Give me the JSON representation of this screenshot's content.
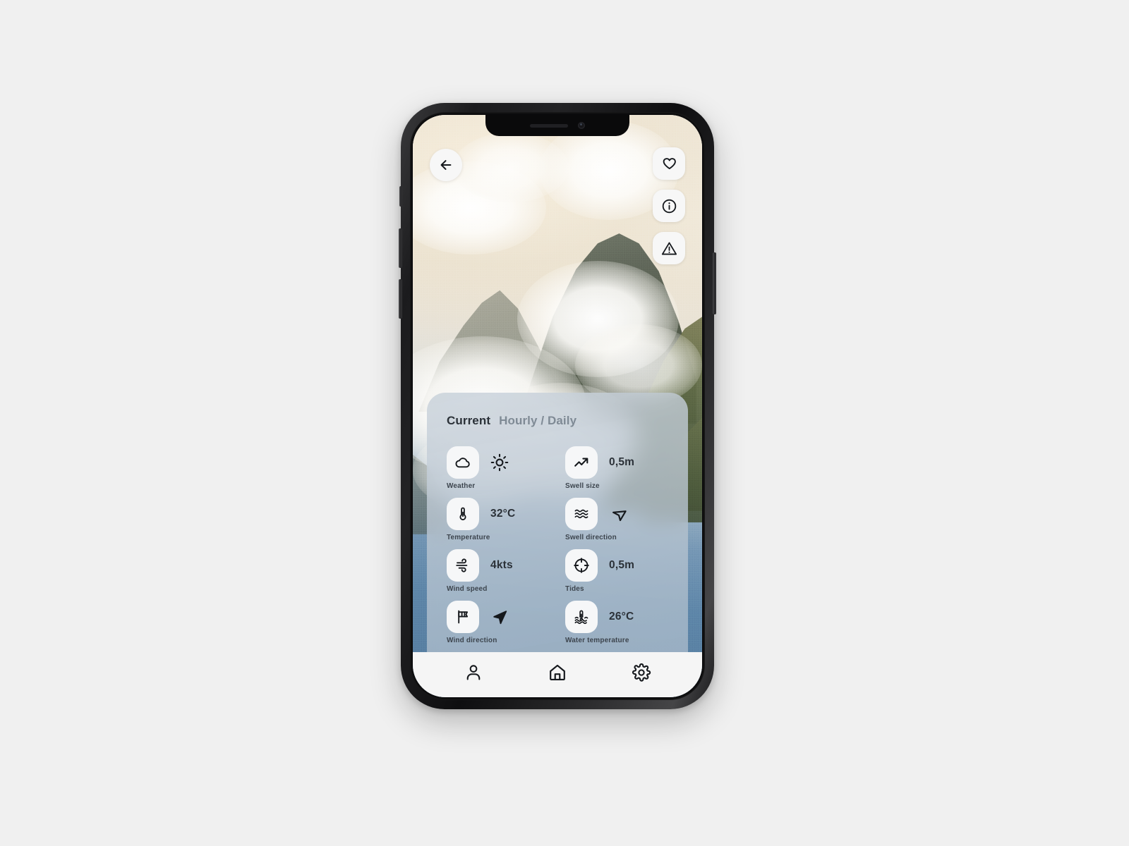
{
  "app": {
    "device": "iphone-x",
    "screen_background": "misty-mountain-lake-photo"
  },
  "header": {
    "back_button": {
      "icon": "arrow-left-icon",
      "label": "Back"
    },
    "actions": [
      {
        "icon": "heart-icon",
        "label": "Favorite"
      },
      {
        "icon": "info-icon",
        "label": "Information"
      },
      {
        "icon": "warning-icon",
        "label": "Alerts"
      }
    ]
  },
  "card": {
    "tabs": [
      {
        "id": "current",
        "label": "Current",
        "active": true
      },
      {
        "id": "hourly-daily",
        "label": "Hourly / Daily",
        "active": false
      }
    ],
    "metrics": [
      {
        "id": "weather",
        "label": "Weather",
        "icon": "cloud-icon",
        "value": "",
        "value_icon": "sun-icon"
      },
      {
        "id": "swell-size",
        "label": "Swell size",
        "icon": "trending-up-icon",
        "value": "0,5m",
        "value_icon": ""
      },
      {
        "id": "temperature",
        "label": "Temperature",
        "icon": "thermometer-icon",
        "value": "32°C",
        "value_icon": ""
      },
      {
        "id": "swell-direction",
        "label": "Swell direction",
        "icon": "waves-icon",
        "value": "",
        "value_icon": "navigation-outline-icon"
      },
      {
        "id": "wind-speed",
        "label": "Wind speed",
        "icon": "wind-icon",
        "value": "4kts",
        "value_icon": ""
      },
      {
        "id": "tides",
        "label": "Tides",
        "icon": "crosshair-icon",
        "value": "0,5m",
        "value_icon": ""
      },
      {
        "id": "wind-direction",
        "label": "Wind direction",
        "icon": "windsock-flag-icon",
        "value": "",
        "value_icon": "navigation-filled-icon"
      },
      {
        "id": "water-temperature",
        "label": "Water temperature",
        "icon": "water-thermometer-icon",
        "value": "26°C",
        "value_icon": ""
      }
    ]
  },
  "bottom_nav": [
    {
      "id": "profile",
      "icon": "person-icon",
      "label": "Profile",
      "active": false
    },
    {
      "id": "home",
      "icon": "home-icon",
      "label": "Home",
      "active": true
    },
    {
      "id": "settings",
      "icon": "gear-icon",
      "label": "Settings",
      "active": false
    }
  ],
  "colors": {
    "page_background": "#f0f0f0",
    "tile_background": "#f6f7f8",
    "icon_stroke": "#15181c",
    "text_primary": "#2b3138",
    "text_muted": "#7f8a95",
    "nav_background": "#f5f5f5",
    "card_tint": "#b9c6d3"
  }
}
